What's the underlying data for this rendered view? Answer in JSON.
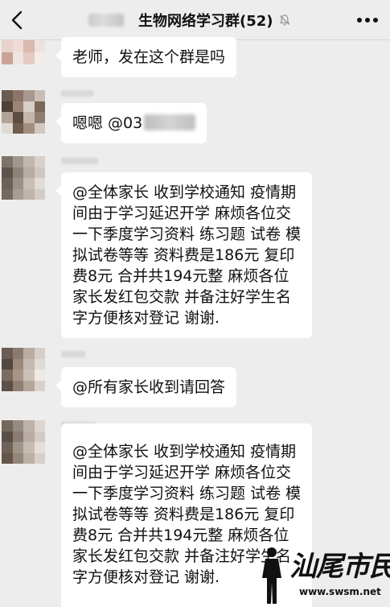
{
  "header": {
    "title": "生物网络学习群(52)",
    "back_icon": "chevron-left-icon",
    "mute_icon": "bell-muted-icon",
    "more_icon": "more-dots-icon"
  },
  "messages": [
    {
      "text_lines": [
        "老师，发在这个群是吗"
      ]
    },
    {
      "text_prefix": "嗯嗯 @03"
    },
    {
      "text_lines": [
        "@全体家长 收到学校通知 疫情期",
        "间由于学习延迟开学 麻烦各位交",
        "一下季度学习资料 练习题 试卷 模",
        "拟试卷等等 资料费是186元 复印",
        "费8元 合并共194元整 麻烦各位",
        "家长发红包交款 并备注好学生名",
        "字方便核对登记 谢谢."
      ]
    },
    {
      "text_lines": [
        "@所有家长收到请回答"
      ]
    },
    {
      "text_lines": [
        "@全体家长 收到学校通知 疫情期",
        "间由于学习延迟开学 麻烦各位交",
        "一下季度学习资料 练习题 试卷 模",
        "拟试卷等等 资料费是186元 复印",
        "费8元 合并共194元整 麻烦各位",
        "家长发红包交款 并备注好学生名",
        "字方便核对登记 谢谢."
      ]
    }
  ],
  "watermark": {
    "logo_text": "汕尾市民网",
    "url": "www.swsm.net"
  }
}
